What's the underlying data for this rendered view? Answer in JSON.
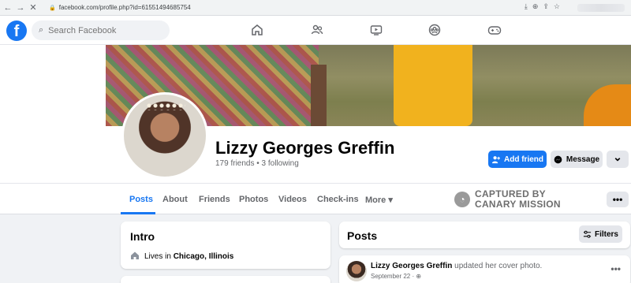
{
  "browser": {
    "url": "facebook.com/profile.php?id=61551494685754",
    "back_glyph": "←",
    "forward_glyph": "→",
    "reload_glyph": "✕"
  },
  "nav": {
    "logo": "f",
    "search_placeholder": "Search Facebook"
  },
  "profile": {
    "name": "Lizzy Georges Greffin",
    "friends_line": "179 friends • 3 following",
    "add_friend_label": "Add friend",
    "message_label": "Message",
    "more_glyph": "⌄"
  },
  "tabs": [
    {
      "label": "Posts",
      "active": true
    },
    {
      "label": "About"
    },
    {
      "label": "Friends"
    },
    {
      "label": "Photos"
    },
    {
      "label": "Videos"
    },
    {
      "label": "Check-ins"
    },
    {
      "label": "More ▾"
    }
  ],
  "watermark": {
    "line1": "CAPTURED BY",
    "line2": "CANARY MISSION"
  },
  "tabs_more_glyph": "•••",
  "intro": {
    "title": "Intro",
    "lives_prefix": "Lives in",
    "location": "Chicago, Illinois"
  },
  "posts": {
    "title": "Posts",
    "filters_label": "Filters",
    "items": [
      {
        "author": "Lizzy Georges Greffin",
        "action": "updated her cover photo.",
        "date": "September 22 · ⊕"
      }
    ]
  },
  "colors": {
    "brand": "#1877f2",
    "background": "#f0f2f5"
  }
}
